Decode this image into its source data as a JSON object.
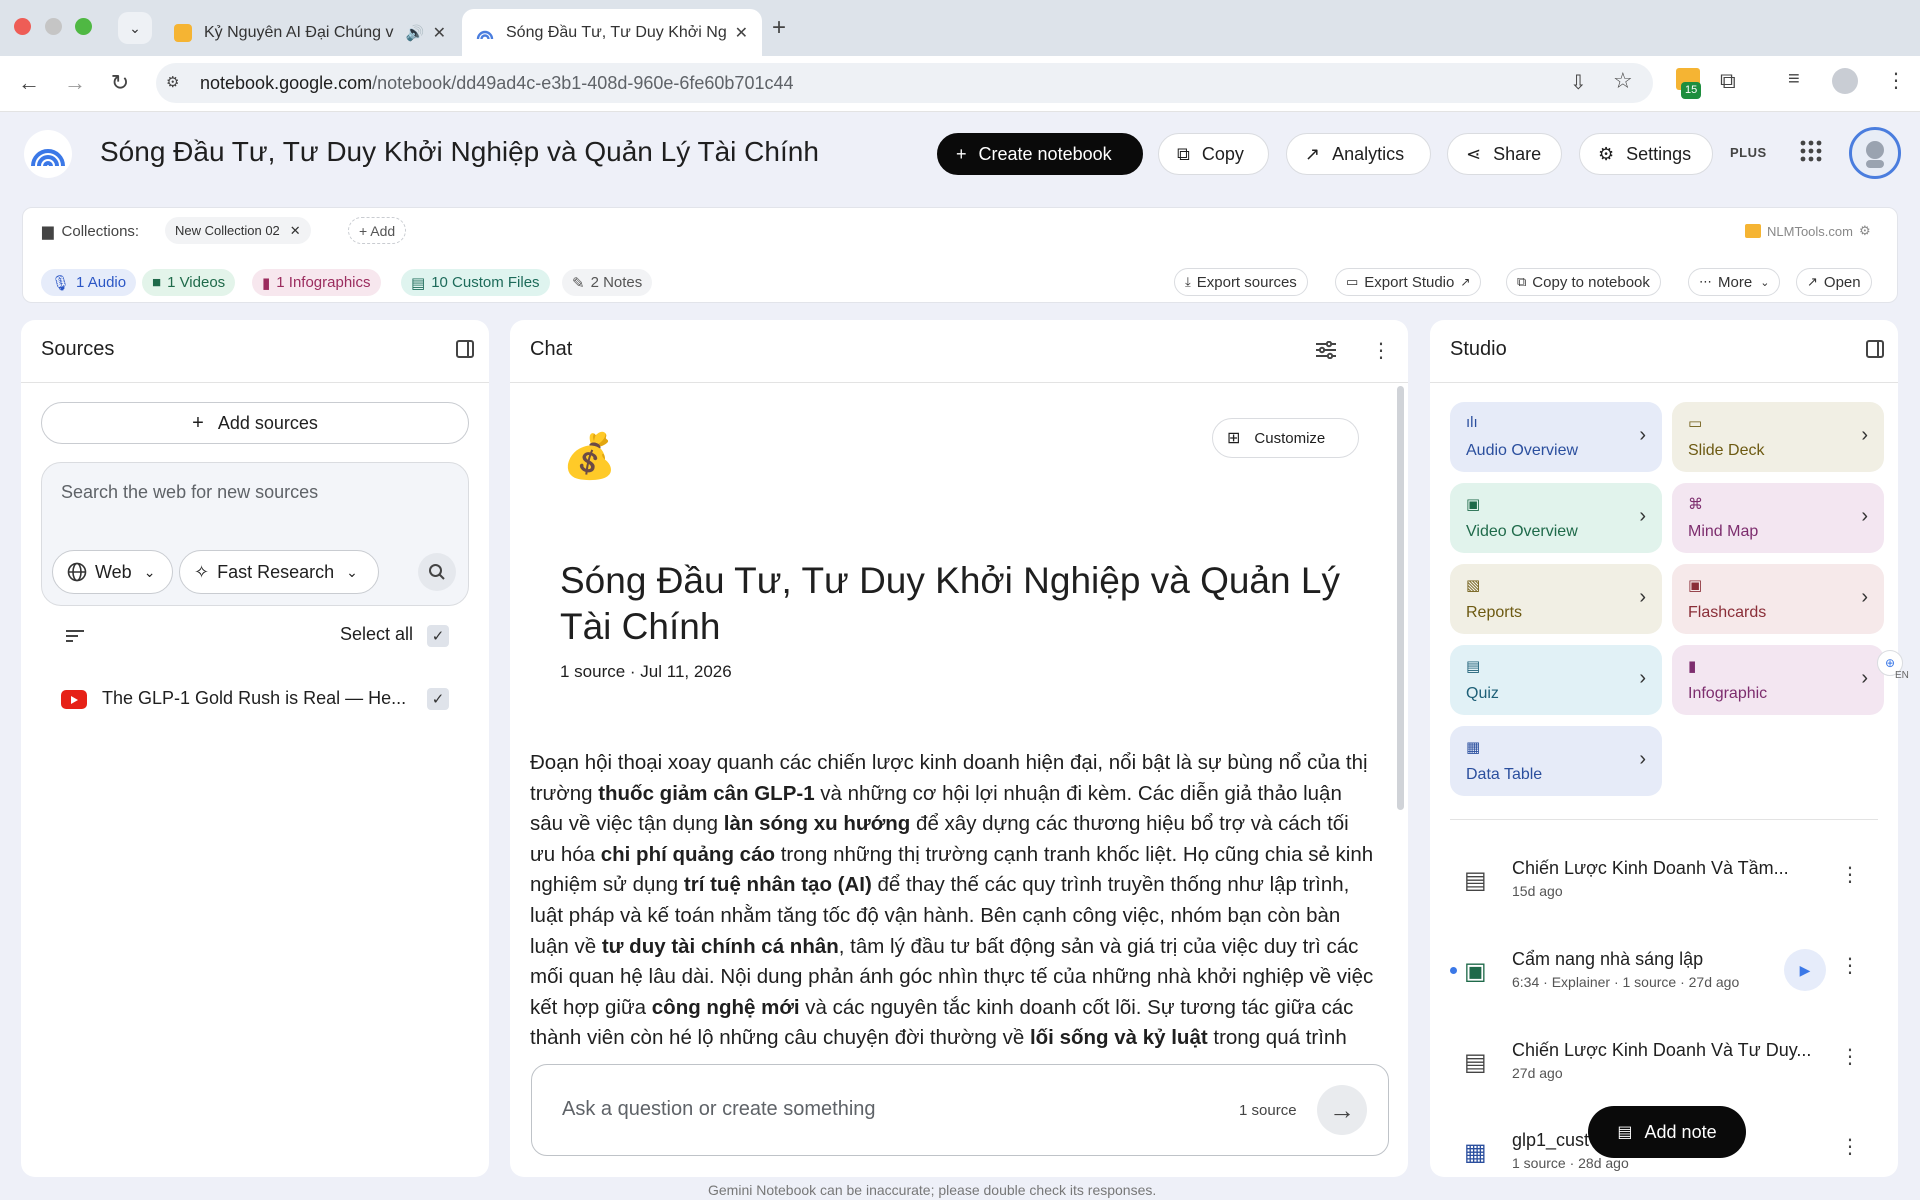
{
  "browser": {
    "tabs": [
      {
        "title": "Kỷ Nguyên AI Đại Chúng v",
        "active": false,
        "favicon_color": "#f5b433"
      },
      {
        "title": "Sóng Đầu Tư, Tư Duy Khởi Ng",
        "active": true,
        "favicon_color": "#4a7dde"
      }
    ],
    "url_domain": "notebook.google.com",
    "url_path": "/notebook/dd49ad4c-e3b1-408d-960e-6fe60b701c44",
    "extension_badge": "15"
  },
  "header": {
    "title": "Sóng Đầu Tư, Tư Duy Khởi Nghiệp và Quản Lý Tài Chính",
    "create_label": "Create notebook",
    "copy_label": "Copy",
    "analytics_label": "Analytics",
    "share_label": "Share",
    "settings_label": "Settings",
    "plan_badge": "PLUS"
  },
  "extension": {
    "collections_label": "Collections:",
    "collection_chip": "New Collection 02",
    "add_label": "+ Add",
    "brand": "NLMTools.com",
    "chips": {
      "audio": "1 Audio",
      "videos": "1 Videos",
      "infographics": "1 Infographics",
      "custom_files": "10 Custom Files",
      "notes": "2 Notes"
    },
    "actions": {
      "export_sources": "Export sources",
      "export_studio": "Export Studio",
      "copy_to_notebook": "Copy to notebook",
      "more": "More",
      "open": "Open"
    }
  },
  "sources": {
    "title": "Sources",
    "add_label": "Add sources",
    "search_placeholder": "Search the web for new sources",
    "web_label": "Web",
    "research_label": "Fast Research",
    "select_all_label": "Select all",
    "items": [
      {
        "title": "The GLP-1 Gold Rush is Real — He..."
      }
    ]
  },
  "chat": {
    "title": "Chat",
    "customize_label": "Customize",
    "emoji": "💰",
    "notebook_title": "Sóng Đầu Tư, Tư Duy Khởi Nghiệp và Quản Lý Tài Chính",
    "meta": "1 source · Jul 11, 2026",
    "summary": [
      {
        "t": "Đoạn hội thoại xoay quanh các chiến lược kinh doanh hiện đại, nổi bật là sự bùng nổ của thị trường "
      },
      {
        "t": "thuốc giảm cân GLP-1",
        "b": true
      },
      {
        "t": " và những cơ hội lợi nhuận đi kèm. Các diễn giả thảo luận sâu về việc tận dụng "
      },
      {
        "t": "làn sóng xu hướng",
        "b": true
      },
      {
        "t": " để xây dựng các thương hiệu bổ trợ và cách tối ưu hóa "
      },
      {
        "t": "chi phí quảng cáo",
        "b": true
      },
      {
        "t": " trong những thị trường cạnh tranh khốc liệt. Họ cũng chia sẻ kinh nghiệm sử dụng "
      },
      {
        "t": "trí tuệ nhân tạo (AI)",
        "b": true
      },
      {
        "t": " để thay thế các quy trình truyền thống như lập trình, luật pháp và kế toán nhằm tăng tốc độ vận hành. Bên cạnh công việc, nhóm bạn còn bàn luận về "
      },
      {
        "t": "tư duy tài chính cá nhân",
        "b": true
      },
      {
        "t": ", tâm lý đầu tư bất động sản và giá trị của việc duy trì các mối quan hệ lâu dài. Nội dung phản ánh góc nhìn thực tế của những nhà khởi nghiệp về việc kết hợp giữa "
      },
      {
        "t": "công nghệ mới",
        "b": true
      },
      {
        "t": " và các nguyên tắc kinh doanh cốt lõi. Sự tương tác giữa các thành viên còn hé lộ những câu chuyện đời thường về "
      },
      {
        "t": "lối sống và kỷ luật",
        "b": true
      },
      {
        "t": " trong quá trình trưởng thành."
      }
    ],
    "input_placeholder": "Ask a question or create something",
    "source_count": "1 source",
    "disclaimer": "Gemini Notebook can be inaccurate; please double check its responses."
  },
  "studio": {
    "title": "Studio",
    "tiles": [
      {
        "label": "Audio Overview",
        "icon": "audio-wave-icon",
        "bg": "#e6ebf8",
        "fg": "#2b4f9e"
      },
      {
        "label": "Slide Deck",
        "icon": "slides-icon",
        "bg": "#f1efe4",
        "fg": "#6d5a12"
      },
      {
        "label": "Video Overview",
        "icon": "video-icon",
        "bg": "#e1f3ec",
        "fg": "#1f6a4a"
      },
      {
        "label": "Mind Map",
        "icon": "mind-map-icon",
        "bg": "#f3e6f1",
        "fg": "#7d2d6e"
      },
      {
        "label": "Reports",
        "icon": "reports-icon",
        "bg": "#f1efe4",
        "fg": "#6d5a12"
      },
      {
        "label": "Flashcards",
        "icon": "flashcards-icon",
        "bg": "#f6e9ea",
        "fg": "#8a2e38"
      },
      {
        "label": "Quiz",
        "icon": "quiz-icon",
        "bg": "#e1f1f6",
        "fg": "#1d5f77"
      },
      {
        "label": "Infographic",
        "icon": "infographic-icon",
        "bg": "#f3e6f1",
        "fg": "#7d2d6e"
      },
      {
        "label": "Data Table",
        "icon": "table-icon",
        "bg": "#e6ebf8",
        "fg": "#2b4f9e"
      }
    ],
    "notes": [
      {
        "title": "Chiến Lược Kinh Doanh Và Tầm...",
        "sub": "15d ago",
        "icon": "note-icon"
      },
      {
        "title": "Cẩm nang nhà sáng lập",
        "sub": "6:34 · Explainer · 1 source · 27d ago",
        "icon": "video-note-icon"
      },
      {
        "title": "Chiến Lược Kinh Doanh Và Tư Duy...",
        "sub": "27d ago",
        "icon": "note-icon"
      },
      {
        "title": "glp1_cust",
        "sub": "1 source · 28d ago",
        "icon": "table-icon"
      }
    ],
    "add_note_label": "Add note"
  }
}
